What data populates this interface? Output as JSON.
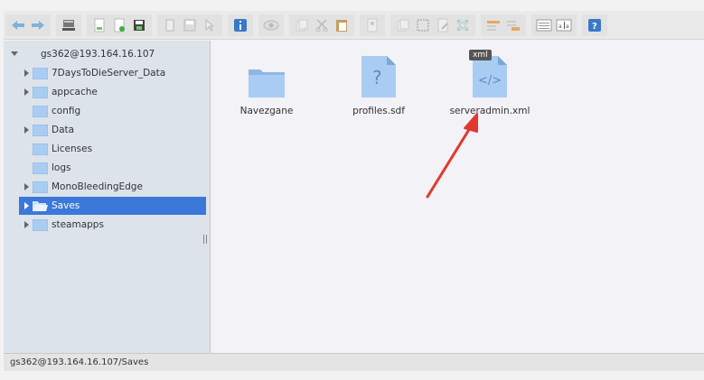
{
  "toolbar": {
    "buttons": [
      [
        "back-icon",
        "forward-icon"
      ],
      [
        "server-icon"
      ],
      [
        "open-file-icon",
        "new-file-icon",
        "save-icon"
      ],
      [
        "copy-path-icon",
        "save-as-icon",
        "select-icon"
      ],
      [
        "info-icon"
      ],
      [
        "preview-icon"
      ],
      [
        "duplicate-icon",
        "cut-icon",
        "paste-icon"
      ],
      [
        "archive-icon"
      ],
      [
        "copy-icon",
        "select-all-icon",
        "edit-icon",
        "resize-icon"
      ],
      [
        "sort-icon",
        "filter-icon"
      ],
      [
        "list-view-icon",
        "rename-icon"
      ],
      [
        "help-icon"
      ]
    ]
  },
  "sidebar": {
    "root": "gs362@193.164.16.107",
    "items": [
      {
        "label": "7DaysToDieServer_Data",
        "expandable": true,
        "selected": false
      },
      {
        "label": "appcache",
        "expandable": true,
        "selected": false
      },
      {
        "label": "config",
        "expandable": false,
        "selected": false
      },
      {
        "label": "Data",
        "expandable": true,
        "selected": false
      },
      {
        "label": "Licenses",
        "expandable": false,
        "selected": false
      },
      {
        "label": "logs",
        "expandable": false,
        "selected": false
      },
      {
        "label": "MonoBleedingEdge",
        "expandable": true,
        "selected": false
      },
      {
        "label": "Saves",
        "expandable": true,
        "selected": true
      },
      {
        "label": "steamapps",
        "expandable": true,
        "selected": false
      }
    ]
  },
  "main": {
    "files": [
      {
        "name": "Navezgane",
        "type": "folder"
      },
      {
        "name": "profiles.sdf",
        "type": "unknown"
      },
      {
        "name": "serveradmin.xml",
        "type": "xml",
        "badge": "xml"
      }
    ]
  },
  "status": {
    "path": "gs362@193.164.16.107/Saves"
  },
  "colors": {
    "selection": "#3b78d9",
    "folder": "#8cb8e8",
    "arrow": "#e0392f"
  }
}
